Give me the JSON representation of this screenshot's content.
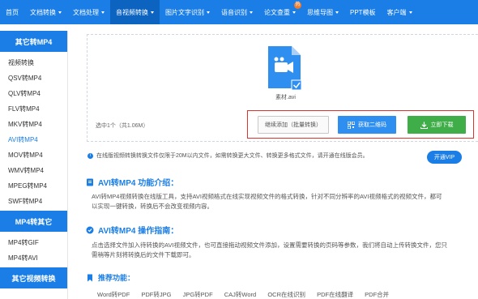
{
  "nav": {
    "items": [
      {
        "label": "首页",
        "caret": false
      },
      {
        "label": "文档转换",
        "caret": true
      },
      {
        "label": "文档处理",
        "caret": true
      },
      {
        "label": "音视频转换",
        "caret": true
      },
      {
        "label": "图片文字识别",
        "caret": true
      },
      {
        "label": "语音识别",
        "caret": true
      },
      {
        "label": "论文查重",
        "caret": true
      },
      {
        "label": "思维导图",
        "caret": true
      },
      {
        "label": "PPT模板",
        "caret": false
      },
      {
        "label": "客户端",
        "caret": true
      }
    ],
    "badge": "热"
  },
  "sidebar": {
    "group1_title": "其它转MP4",
    "group1_items": [
      "视频转换",
      "QSV转MP4",
      "QLV转MP4",
      "FLV转MP4",
      "MKV转MP4",
      "AVI转MP4",
      "MOV转MP4",
      "WMV转MP4",
      "MPEG转MP4",
      "SWF转MP4"
    ],
    "group2_title": "MP4转其它",
    "group2_items": [
      "MP4转GIF",
      "MP4转AVI"
    ],
    "group3_title": "其它视频转换"
  },
  "upload": {
    "file_name": "素材.avi",
    "selection_info": "选中1个（共1.06M）",
    "add_button": "继续添加（批量转换）",
    "qr_button": "获取二维码",
    "download_button": "立即下载"
  },
  "notice": {
    "text": "在线版视频转换转换文件仅限于20M以内文件，如需转换更大文件、转换更多格式文件，请开通在线版会员。",
    "vip_button": "开通VIP"
  },
  "intro": {
    "title": "AVI转MP4 功能介绍：",
    "line1": "AVI转MP4视频转换在线版工具，支持AVI视频格式在线实现视频文件的格式转换，针对不同分辨率的AVI视频格式的视频文件，都可",
    "line2": "以实现一键转换，转换后不会改变视频内容。"
  },
  "guide": {
    "title": "AVI转MP4 操作指南：",
    "line1": "点击选择文件加入待转换的AVI视频文件，也可直接拖动视频文件添加，设置需要转换的页码等参数，我们将自动上传转换文件，您只",
    "line2": "需稍等片刻将转换后的文件下载即可。"
  },
  "related": {
    "title": "推荐功能：",
    "items": [
      "Word转PDF",
      "PDF转JPG",
      "JPG转PDF",
      "CAJ转Word",
      "OCR在线识别",
      "PDF在线翻译",
      "PDF合并"
    ]
  },
  "colors": {
    "brand": "#1a7ee6",
    "download": "#3fae49",
    "highlight_frame": "#e0322c"
  }
}
